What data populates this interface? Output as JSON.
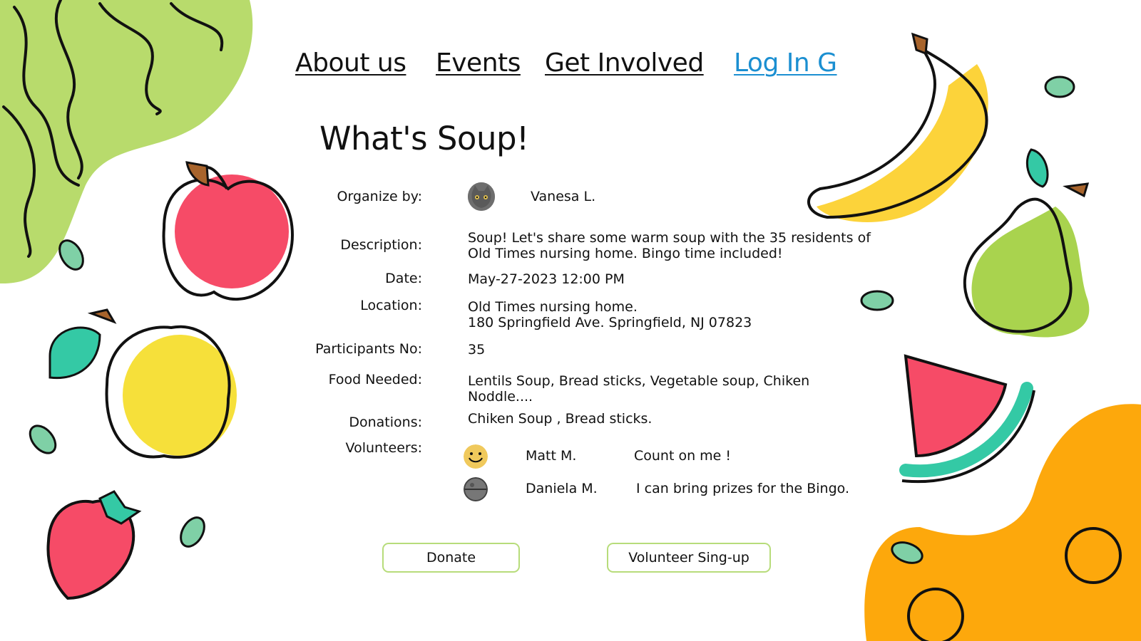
{
  "nav": {
    "about": "About us",
    "events": "Events",
    "get_involved": "Get Involved",
    "login": "Log In G"
  },
  "event": {
    "title": "What's Soup!",
    "organizer_label": "Organize by:",
    "organizer_name": "Vanesa L.",
    "description_label": "Description:",
    "description_line1": "Soup! Let's share some warm soup with the 35 residents of",
    "description_line2": "Old Times nursing home. Bingo time included!",
    "date_label": "Date:",
    "date": "May-27-2023 12:00 PM",
    "location_label": "Location:",
    "location_line1": "Old Times nursing home.",
    "location_line2": "180 Springfield Ave. Springfield, NJ 07823",
    "participants_label": "Participants No:",
    "participants": "35",
    "food_label": "Food Needed:",
    "food_line1": "Lentils Soup, Bread sticks, Vegetable soup, Chiken",
    "food_line2": "Noddle....",
    "donations_label": "Donations:",
    "donations": "Chiken Soup , Bread sticks.",
    "volunteers_label": "Volunteers:",
    "volunteers": [
      {
        "name": "Matt M.",
        "message": "Count on me !"
      },
      {
        "name": "Daniela M.",
        "message": "I can bring prizes for the Bingo."
      }
    ]
  },
  "buttons": {
    "donate": "Donate",
    "volunteer_signup": "Volunteer Sing-up"
  },
  "colors": {
    "login_link": "#1b8fd1",
    "button_border": "#b7dc7a",
    "blob_green": "#b8db6c",
    "blob_orange": "#fda80c",
    "apple": "#f64b67",
    "banana": "#fcd33a",
    "lemon": "#f6e03a",
    "pear": "#a9d34e",
    "watermelon": "#f64b67",
    "leaf": "#34c9a5"
  }
}
